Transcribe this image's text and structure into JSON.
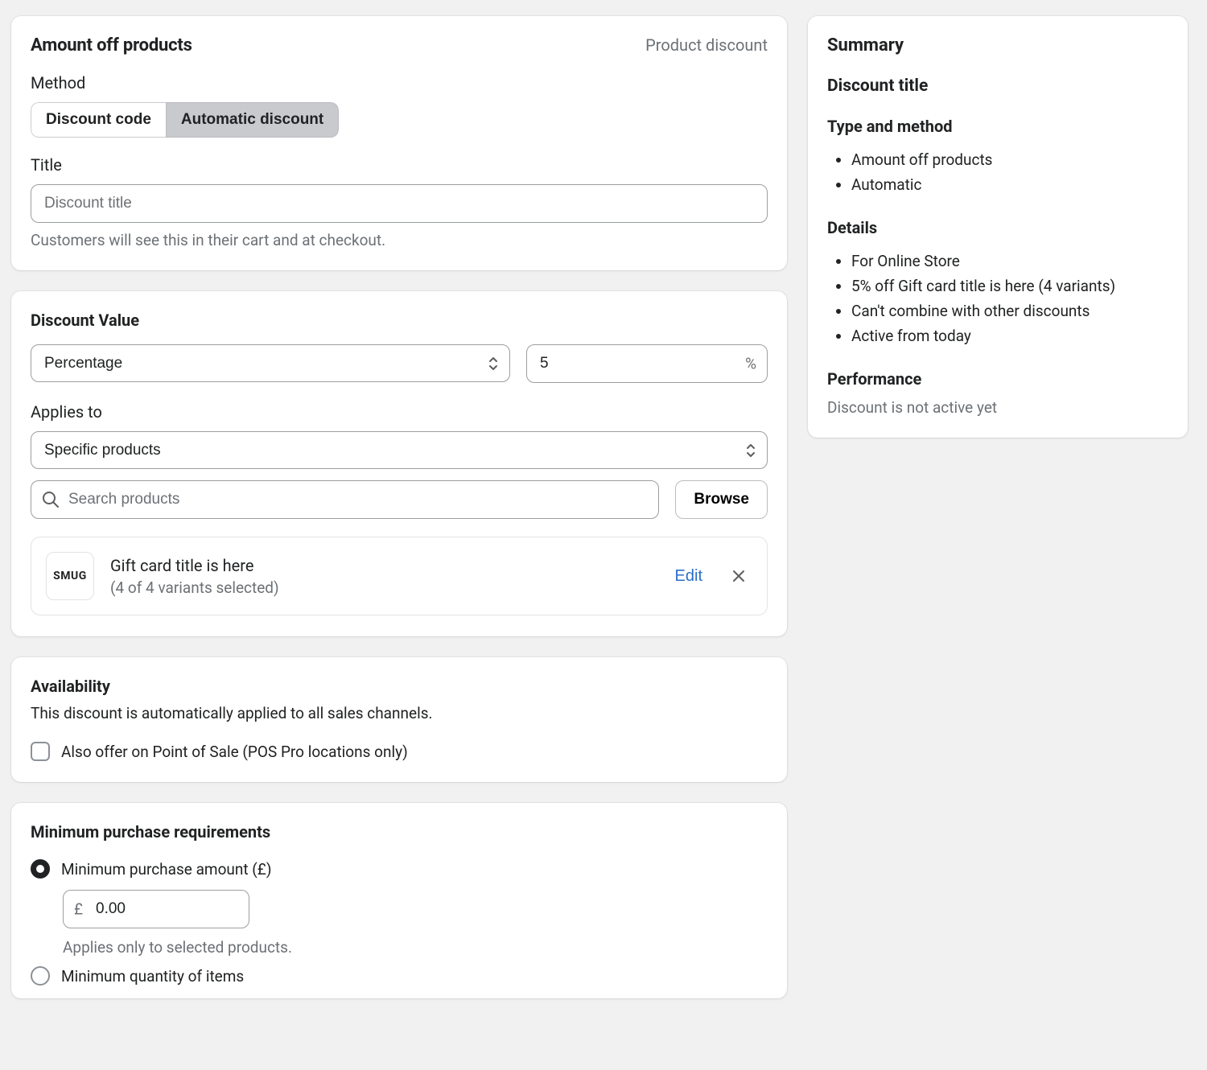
{
  "header": {
    "title": "Amount off products",
    "type_label": "Product discount"
  },
  "method": {
    "label": "Method",
    "option_code": "Discount code",
    "option_auto": "Automatic discount",
    "selected": "auto"
  },
  "title_field": {
    "label": "Title",
    "placeholder": "Discount title",
    "value": "",
    "help": "Customers will see this in their cart and at checkout."
  },
  "discount_value": {
    "heading": "Discount Value",
    "type_selected": "Percentage",
    "amount": "5",
    "suffix": "%"
  },
  "applies_to": {
    "label": "Applies to",
    "selected": "Specific products",
    "search_placeholder": "Search products",
    "browse_label": "Browse"
  },
  "product": {
    "thumb_text": "SMUG",
    "title": "Gift card title is here",
    "variants": "(4 of 4 variants selected)",
    "edit_label": "Edit"
  },
  "availability": {
    "heading": "Availability",
    "desc": "This discount is automatically applied to all sales channels.",
    "pos_label": "Also offer on Point of Sale (POS Pro locations only)",
    "pos_checked": false
  },
  "min_req": {
    "heading": "Minimum purchase requirements",
    "opt_amount_label": "Minimum purchase amount (£)",
    "opt_qty_label": "Minimum quantity of items",
    "selected": "amount",
    "currency_prefix": "£",
    "amount_value": "0.00",
    "amount_help": "Applies only to selected products."
  },
  "summary": {
    "heading": "Summary",
    "discount_title": "Discount title",
    "type_method_heading": "Type and method",
    "type_method_items": [
      "Amount off products",
      "Automatic"
    ],
    "details_heading": "Details",
    "details_items": [
      "For Online Store",
      "5% off Gift card title is here (4 variants)",
      "Can't combine with other discounts",
      "Active from today"
    ],
    "performance_heading": "Performance",
    "performance_text": "Discount is not active yet"
  }
}
